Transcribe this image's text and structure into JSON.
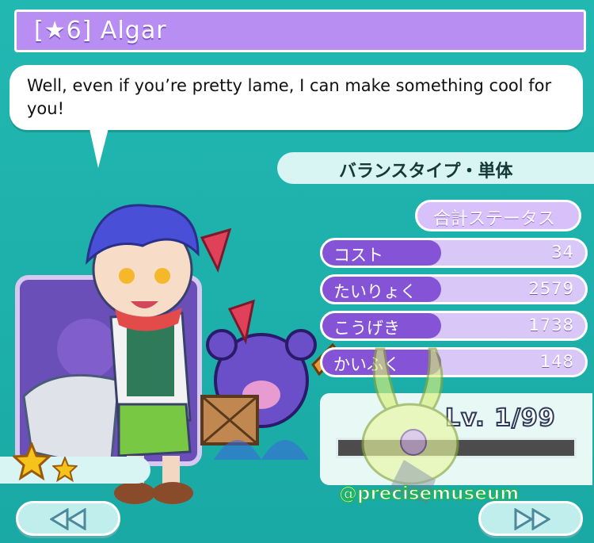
{
  "title": "[★6] Algar",
  "quote": "Well, even if you’re pretty lame, I can make something cool for you!",
  "type_label": "バランスタイプ・単体",
  "status_header": "合計ステータス",
  "stats": [
    {
      "label": "コスト",
      "value": "34"
    },
    {
      "label": "たいりょく",
      "value": "2579"
    },
    {
      "label": "こうげき",
      "value": "1738"
    },
    {
      "label": "かいふく",
      "value": "148"
    }
  ],
  "level": {
    "text": "Lv. 1/99",
    "progress": 0.0
  },
  "watermark": "@precisemuseum",
  "rarity": {
    "large_stars": 1,
    "small_stars": 1
  },
  "colors": {
    "background": "#1fb3ae",
    "accent": "#b98ef2",
    "stat_label": "#8553d6"
  },
  "icons": [
    "prev-page-icon",
    "next-page-icon",
    "star-icon"
  ]
}
